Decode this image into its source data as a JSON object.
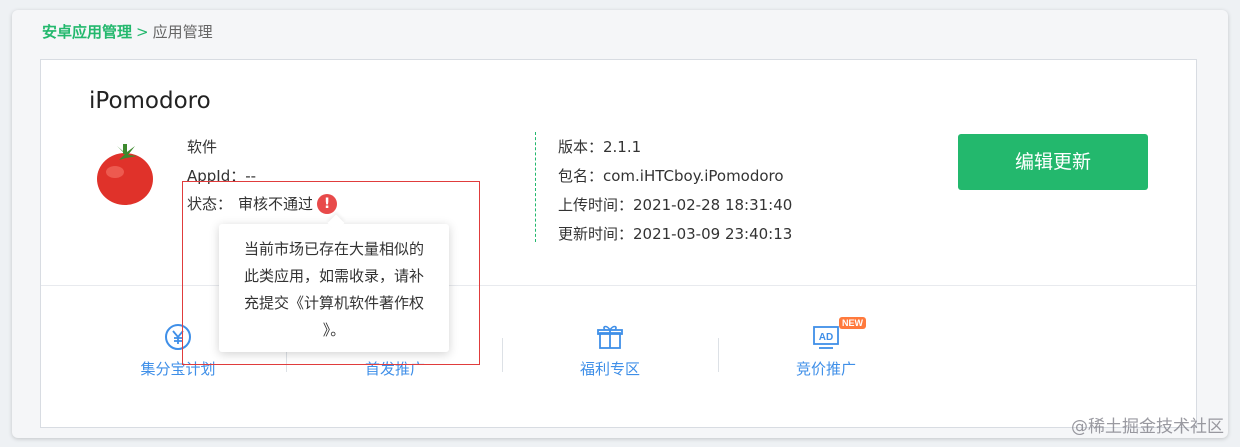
{
  "breadcrumb": {
    "parent": "安卓应用管理",
    "separator": ">",
    "current": "应用管理"
  },
  "app": {
    "name": "iPomodoro",
    "category": "软件",
    "appid_label": "AppId：",
    "appid_value": "--",
    "status_label": "状态：",
    "status_value": "审核不通过",
    "status_icon": "exclamation-icon",
    "version": "版本：2.1.1",
    "package": "包名：com.iHTCboy.iPomodoro",
    "upload_time": "上传时间：2021-02-28 18:31:40",
    "update_time": "更新时间：2021-03-09 23:40:13"
  },
  "actions": {
    "edit_update": "编辑更新"
  },
  "tooltip": {
    "line1": "当前市场已存在大量相似的",
    "line2": "此类应用，如需收录，请补",
    "line3": "充提交《计算机软件著作权",
    "line4": "》。"
  },
  "promos": [
    {
      "label": "集分宝计划",
      "icon": "yuan-coin-icon"
    },
    {
      "label": "首发推广",
      "icon": "launch-icon"
    },
    {
      "label": "福利专区",
      "icon": "gift-icon"
    },
    {
      "label": "竞价推广",
      "icon": "ad-icon",
      "badge": "NEW"
    }
  ],
  "watermark": "@稀土掘金技术社区",
  "colors": {
    "accent": "#23b86d",
    "link_blue": "#3f8fe8",
    "error_red": "#e84a4a",
    "highlight_border": "#e03c3c"
  }
}
